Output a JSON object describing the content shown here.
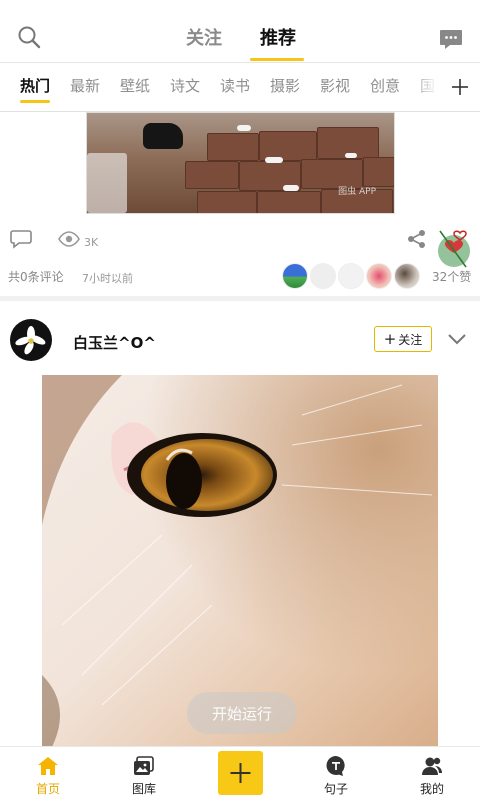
{
  "top_tabs": {
    "follow": "关注",
    "recommend": "推荐"
  },
  "categories": [
    "热门",
    "最新",
    "壁纸",
    "诗文",
    "读书",
    "摄影",
    "影视",
    "创意",
    "国风"
  ],
  "feed": {
    "post1": {
      "image_watermark": "图虫 APP",
      "views": "3K",
      "comments_text": "共0条评论",
      "time": "7小时以前",
      "likes_text": "32个赞"
    },
    "post2": {
      "username": "白玉兰^O^",
      "follow_label": "关注",
      "overlay_text": "开始运行"
    }
  },
  "bottom_nav": {
    "home": "首页",
    "gallery": "图库",
    "sentence": "句子",
    "mine": "我的"
  },
  "colors": {
    "accent": "#f5c518",
    "home_active": "#e3a800",
    "publish": "#f7c815"
  },
  "icons": [
    "search-icon",
    "message-icon",
    "plus-icon",
    "comment-icon",
    "eye-icon",
    "share-icon",
    "heart-icon",
    "chevron-down-icon",
    "home-icon",
    "gallery-icon",
    "sentence-icon",
    "user-icon"
  ]
}
